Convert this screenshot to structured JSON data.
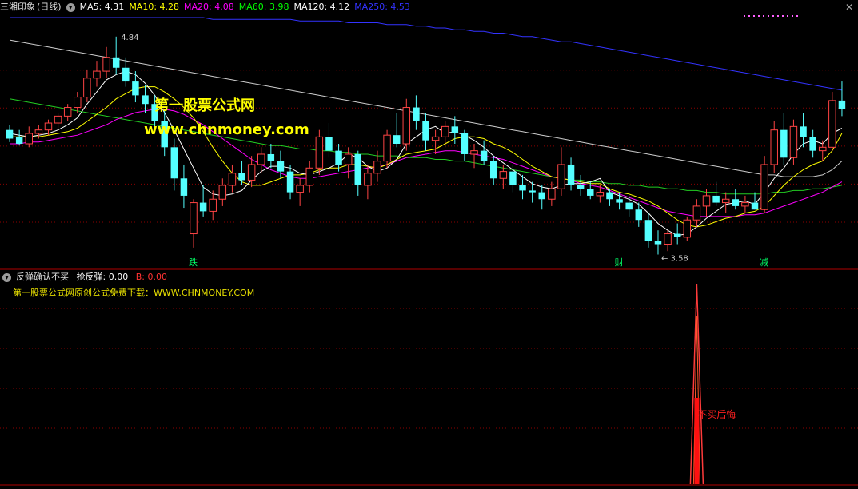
{
  "header": {
    "title": "三湘印象",
    "period": "(日线)",
    "ma_labels": [
      {
        "text": "MA5: 4.31",
        "color": "#ffffff"
      },
      {
        "text": "MA10: 4.28",
        "color": "#ffff00"
      },
      {
        "text": "MA20: 4.08",
        "color": "#ff00ff"
      },
      {
        "text": "MA60: 3.98",
        "color": "#00ff00"
      },
      {
        "text": "MA120: 4.12",
        "color": "#ffffff"
      },
      {
        "text": "MA250: 4.53",
        "color": "#3333ff"
      }
    ]
  },
  "indicator": {
    "name": "反弹确认不买",
    "v1": "抢反弹: 0.00",
    "v1_color": "#ffffff",
    "v2": "B: 0.00",
    "v2_color": "#ff3333",
    "note": "第一股票公式网原创公式免费下载：WWW.CHNMONEY.COM",
    "signal_label": "不买后悔"
  },
  "watermark": {
    "line1": "第一股票公式网",
    "line2": "www.chnmoney.com"
  },
  "colors": {
    "up": "#ff4444",
    "down": "#54ffff",
    "grid": "#8b0000",
    "ma5": "#ffffff",
    "ma10": "#ffff00",
    "ma20": "#ff00ff",
    "ma60": "#22cc22",
    "ma120": "#cccccc",
    "ma250": "#3333ff"
  },
  "chart_data": {
    "type": "candlestick",
    "price_range": [
      3.55,
      4.95
    ],
    "high_annotation": "4.84",
    "low_annotation": "3.58",
    "markers": [
      "跌",
      "财",
      "减"
    ],
    "ohlc": [
      [
        4.3,
        4.33,
        4.23,
        4.25
      ],
      [
        4.26,
        4.3,
        4.21,
        4.22
      ],
      [
        4.22,
        4.32,
        4.2,
        4.28
      ],
      [
        4.28,
        4.33,
        4.25,
        4.3
      ],
      [
        4.3,
        4.36,
        4.27,
        4.34
      ],
      [
        4.34,
        4.4,
        4.31,
        4.38
      ],
      [
        4.38,
        4.45,
        4.35,
        4.43
      ],
      [
        4.43,
        4.52,
        4.4,
        4.49
      ],
      [
        4.49,
        4.65,
        4.46,
        4.6
      ],
      [
        4.6,
        4.7,
        4.55,
        4.64
      ],
      [
        4.64,
        4.78,
        4.6,
        4.72
      ],
      [
        4.72,
        4.84,
        4.62,
        4.66
      ],
      [
        4.66,
        4.72,
        4.55,
        4.58
      ],
      [
        4.58,
        4.64,
        4.46,
        4.5
      ],
      [
        4.5,
        4.56,
        4.4,
        4.45
      ],
      [
        4.45,
        4.5,
        4.3,
        4.35
      ],
      [
        4.35,
        4.42,
        4.15,
        4.2
      ],
      [
        4.2,
        4.25,
        3.95,
        4.02
      ],
      [
        4.02,
        4.1,
        3.85,
        3.92
      ],
      [
        3.7,
        3.9,
        3.62,
        3.88
      ],
      [
        3.88,
        3.98,
        3.8,
        3.83
      ],
      [
        3.83,
        3.95,
        3.78,
        3.9
      ],
      [
        3.9,
        4.02,
        3.86,
        3.98
      ],
      [
        3.98,
        4.1,
        3.94,
        4.05
      ],
      [
        4.05,
        4.12,
        3.98,
        4.01
      ],
      [
        4.01,
        4.15,
        3.97,
        4.1
      ],
      [
        4.1,
        4.2,
        4.05,
        4.16
      ],
      [
        4.16,
        4.22,
        4.08,
        4.12
      ],
      [
        4.12,
        4.18,
        4.02,
        4.06
      ],
      [
        4.06,
        4.1,
        3.9,
        3.94
      ],
      [
        3.94,
        4.02,
        3.86,
        3.98
      ],
      [
        3.98,
        4.12,
        3.94,
        4.08
      ],
      [
        4.08,
        4.3,
        4.04,
        4.26
      ],
      [
        4.26,
        4.34,
        4.14,
        4.18
      ],
      [
        4.18,
        4.22,
        4.06,
        4.1
      ],
      [
        4.1,
        4.2,
        4.02,
        4.16
      ],
      [
        4.16,
        4.18,
        3.92,
        3.98
      ],
      [
        3.98,
        4.1,
        3.9,
        4.05
      ],
      [
        4.05,
        4.18,
        4.0,
        4.12
      ],
      [
        4.12,
        4.3,
        4.08,
        4.27
      ],
      [
        4.27,
        4.4,
        4.2,
        4.22
      ],
      [
        4.22,
        4.48,
        4.18,
        4.43
      ],
      [
        4.43,
        4.5,
        4.3,
        4.35
      ],
      [
        4.35,
        4.4,
        4.18,
        4.24
      ],
      [
        4.24,
        4.3,
        4.16,
        4.26
      ],
      [
        4.26,
        4.35,
        4.2,
        4.32
      ],
      [
        4.32,
        4.38,
        4.22,
        4.28
      ],
      [
        4.28,
        4.3,
        4.12,
        4.16
      ],
      [
        4.16,
        4.22,
        4.08,
        4.18
      ],
      [
        4.18,
        4.24,
        4.1,
        4.12
      ],
      [
        4.12,
        4.15,
        3.98,
        4.02
      ],
      [
        4.02,
        4.1,
        3.96,
        4.06
      ],
      [
        4.06,
        4.1,
        3.94,
        3.98
      ],
      [
        3.98,
        4.04,
        3.9,
        3.95
      ],
      [
        3.95,
        4.0,
        3.88,
        3.94
      ],
      [
        3.94,
        3.98,
        3.84,
        3.9
      ],
      [
        3.9,
        4.0,
        3.86,
        3.96
      ],
      [
        3.96,
        4.2,
        3.92,
        4.1
      ],
      [
        4.1,
        4.14,
        3.95,
        3.98
      ],
      [
        3.98,
        4.04,
        3.92,
        3.96
      ],
      [
        3.96,
        4.0,
        3.9,
        3.92
      ],
      [
        3.92,
        3.98,
        3.88,
        3.94
      ],
      [
        3.94,
        3.96,
        3.86,
        3.9
      ],
      [
        3.9,
        3.94,
        3.84,
        3.88
      ],
      [
        3.88,
        3.92,
        3.8,
        3.84
      ],
      [
        3.84,
        3.88,
        3.74,
        3.78
      ],
      [
        3.78,
        3.82,
        3.62,
        3.66
      ],
      [
        3.66,
        3.72,
        3.58,
        3.64
      ],
      [
        3.64,
        3.72,
        3.6,
        3.7
      ],
      [
        3.7,
        3.76,
        3.64,
        3.68
      ],
      [
        3.68,
        3.8,
        3.66,
        3.78
      ],
      [
        3.78,
        3.9,
        3.74,
        3.86
      ],
      [
        3.86,
        3.96,
        3.8,
        3.92
      ],
      [
        3.92,
        4.0,
        3.86,
        3.88
      ],
      [
        3.88,
        3.94,
        3.82,
        3.9
      ],
      [
        3.9,
        3.96,
        3.84,
        3.86
      ],
      [
        3.86,
        3.92,
        3.82,
        3.88
      ],
      [
        3.88,
        3.94,
        3.84,
        3.84
      ],
      [
        3.84,
        4.15,
        3.82,
        4.1
      ],
      [
        4.1,
        4.35,
        4.05,
        4.3
      ],
      [
        4.3,
        4.4,
        4.1,
        4.14
      ],
      [
        4.14,
        4.36,
        4.1,
        4.32
      ],
      [
        4.32,
        4.4,
        4.2,
        4.26
      ],
      [
        4.26,
        4.3,
        4.14,
        4.18
      ],
      [
        4.18,
        4.24,
        4.12,
        4.2
      ],
      [
        4.2,
        4.52,
        4.18,
        4.47
      ],
      [
        4.47,
        4.58,
        4.38,
        4.42
      ]
    ],
    "ma5": [
      4.28,
      4.27,
      4.26,
      4.27,
      4.28,
      4.3,
      4.33,
      4.37,
      4.45,
      4.52,
      4.59,
      4.62,
      4.64,
      4.62,
      4.57,
      4.5,
      4.4,
      4.3,
      4.19,
      4.08,
      3.97,
      3.93,
      3.92,
      3.93,
      3.95,
      4.01,
      4.06,
      4.09,
      4.09,
      4.08,
      4.05,
      4.04,
      4.06,
      4.08,
      4.11,
      4.16,
      4.14,
      4.09,
      4.06,
      4.08,
      4.13,
      4.22,
      4.26,
      4.3,
      4.32,
      4.28,
      4.29,
      4.27,
      4.24,
      4.2,
      4.15,
      4.11,
      4.07,
      4.03,
      3.99,
      3.97,
      3.96,
      3.98,
      3.99,
      3.99,
      4.0,
      4.02,
      3.94,
      3.92,
      3.9,
      3.87,
      3.82,
      3.76,
      3.72,
      3.69,
      3.7,
      3.74,
      3.79,
      3.83,
      3.87,
      3.88,
      3.89,
      3.87,
      3.94,
      4.02,
      4.08,
      4.16,
      4.22,
      4.24,
      4.22,
      4.28,
      4.31
    ],
    "ma10": [
      4.26,
      4.26,
      4.26,
      4.26,
      4.27,
      4.28,
      4.29,
      4.31,
      4.35,
      4.39,
      4.43,
      4.48,
      4.51,
      4.54,
      4.55,
      4.55,
      4.52,
      4.48,
      4.43,
      4.37,
      4.29,
      4.2,
      4.12,
      4.05,
      4.0,
      3.98,
      3.98,
      4.0,
      4.02,
      4.04,
      4.04,
      4.05,
      4.07,
      4.08,
      4.08,
      4.1,
      4.1,
      4.09,
      4.08,
      4.1,
      4.13,
      4.16,
      4.17,
      4.18,
      4.19,
      4.22,
      4.25,
      4.26,
      4.26,
      4.25,
      4.22,
      4.2,
      4.17,
      4.13,
      4.09,
      4.06,
      4.03,
      4.02,
      4.01,
      4.0,
      3.99,
      3.99,
      3.96,
      3.94,
      3.93,
      3.91,
      3.89,
      3.86,
      3.82,
      3.78,
      3.75,
      3.74,
      3.75,
      3.77,
      3.79,
      3.8,
      3.82,
      3.83,
      3.86,
      3.92,
      3.98,
      4.03,
      4.07,
      4.1,
      4.12,
      4.18,
      4.28
    ],
    "ma20": [
      4.22,
      4.22,
      4.23,
      4.23,
      4.24,
      4.25,
      4.26,
      4.27,
      4.29,
      4.31,
      4.33,
      4.36,
      4.38,
      4.4,
      4.41,
      4.42,
      4.42,
      4.41,
      4.39,
      4.36,
      4.33,
      4.29,
      4.25,
      4.21,
      4.17,
      4.13,
      4.1,
      4.07,
      4.05,
      4.03,
      4.02,
      4.02,
      4.03,
      4.04,
      4.05,
      4.06,
      4.07,
      4.08,
      4.09,
      4.1,
      4.12,
      4.14,
      4.15,
      4.16,
      4.17,
      4.18,
      4.18,
      4.17,
      4.16,
      4.15,
      4.14,
      4.13,
      4.11,
      4.09,
      4.07,
      4.05,
      4.03,
      4.02,
      4.01,
      3.99,
      3.98,
      3.97,
      3.95,
      3.93,
      3.91,
      3.89,
      3.87,
      3.85,
      3.83,
      3.82,
      3.81,
      3.8,
      3.8,
      3.8,
      3.8,
      3.8,
      3.81,
      3.81,
      3.82,
      3.84,
      3.86,
      3.88,
      3.9,
      3.92,
      3.94,
      3.97,
      4.0
    ],
    "ma60": [
      4.48,
      4.47,
      4.46,
      4.45,
      4.44,
      4.43,
      4.42,
      4.41,
      4.4,
      4.39,
      4.38,
      4.37,
      4.36,
      4.35,
      4.34,
      4.33,
      4.32,
      4.31,
      4.3,
      4.29,
      4.28,
      4.27,
      4.26,
      4.25,
      4.24,
      4.23,
      4.22,
      4.21,
      4.21,
      4.2,
      4.19,
      4.19,
      4.18,
      4.18,
      4.17,
      4.17,
      4.16,
      4.16,
      4.15,
      4.15,
      4.15,
      4.14,
      4.14,
      4.14,
      4.13,
      4.13,
      4.12,
      4.12,
      4.11,
      4.1,
      4.09,
      4.08,
      4.07,
      4.06,
      4.05,
      4.04,
      4.03,
      4.02,
      4.01,
      4.01,
      4.0,
      4.0,
      3.99,
      3.99,
      3.98,
      3.98,
      3.97,
      3.97,
      3.96,
      3.96,
      3.95,
      3.95,
      3.94,
      3.94,
      3.93,
      3.93,
      3.93,
      3.93,
      3.93,
      3.94,
      3.94,
      3.95,
      3.95,
      3.96,
      3.96,
      3.97,
      3.98
    ],
    "ma120": [
      4.82,
      4.81,
      4.8,
      4.79,
      4.78,
      4.77,
      4.76,
      4.75,
      4.74,
      4.73,
      4.72,
      4.71,
      4.7,
      4.69,
      4.68,
      4.67,
      4.66,
      4.65,
      4.64,
      4.63,
      4.62,
      4.61,
      4.6,
      4.59,
      4.58,
      4.57,
      4.56,
      4.55,
      4.54,
      4.53,
      4.52,
      4.51,
      4.5,
      4.49,
      4.48,
      4.47,
      4.46,
      4.45,
      4.44,
      4.43,
      4.42,
      4.41,
      4.4,
      4.39,
      4.38,
      4.37,
      4.36,
      4.35,
      4.34,
      4.33,
      4.32,
      4.31,
      4.3,
      4.29,
      4.28,
      4.27,
      4.26,
      4.25,
      4.24,
      4.23,
      4.22,
      4.21,
      4.2,
      4.19,
      4.18,
      4.17,
      4.16,
      4.15,
      4.14,
      4.13,
      4.12,
      4.11,
      4.1,
      4.09,
      4.08,
      4.07,
      4.06,
      4.05,
      4.04,
      4.04,
      4.03,
      4.03,
      4.03,
      4.03,
      4.04,
      4.07,
      4.12
    ],
    "ma250": [
      4.95,
      4.95,
      4.95,
      4.95,
      4.95,
      4.95,
      4.95,
      4.95,
      4.95,
      4.95,
      4.95,
      4.95,
      4.95,
      4.95,
      4.95,
      4.95,
      4.95,
      4.95,
      4.95,
      4.95,
      4.95,
      4.94,
      4.94,
      4.94,
      4.94,
      4.94,
      4.94,
      4.94,
      4.94,
      4.94,
      4.93,
      4.93,
      4.93,
      4.93,
      4.93,
      4.92,
      4.92,
      4.92,
      4.92,
      4.91,
      4.91,
      4.91,
      4.9,
      4.9,
      4.89,
      4.89,
      4.88,
      4.88,
      4.87,
      4.87,
      4.86,
      4.86,
      4.85,
      4.84,
      4.84,
      4.83,
      4.82,
      4.81,
      4.81,
      4.8,
      4.79,
      4.78,
      4.77,
      4.76,
      4.75,
      4.74,
      4.73,
      4.72,
      4.71,
      4.7,
      4.69,
      4.68,
      4.67,
      4.66,
      4.65,
      4.64,
      4.63,
      4.62,
      4.61,
      4.6,
      4.59,
      4.58,
      4.57,
      4.56,
      4.55,
      4.54,
      4.53
    ],
    "signal_index": 71
  }
}
